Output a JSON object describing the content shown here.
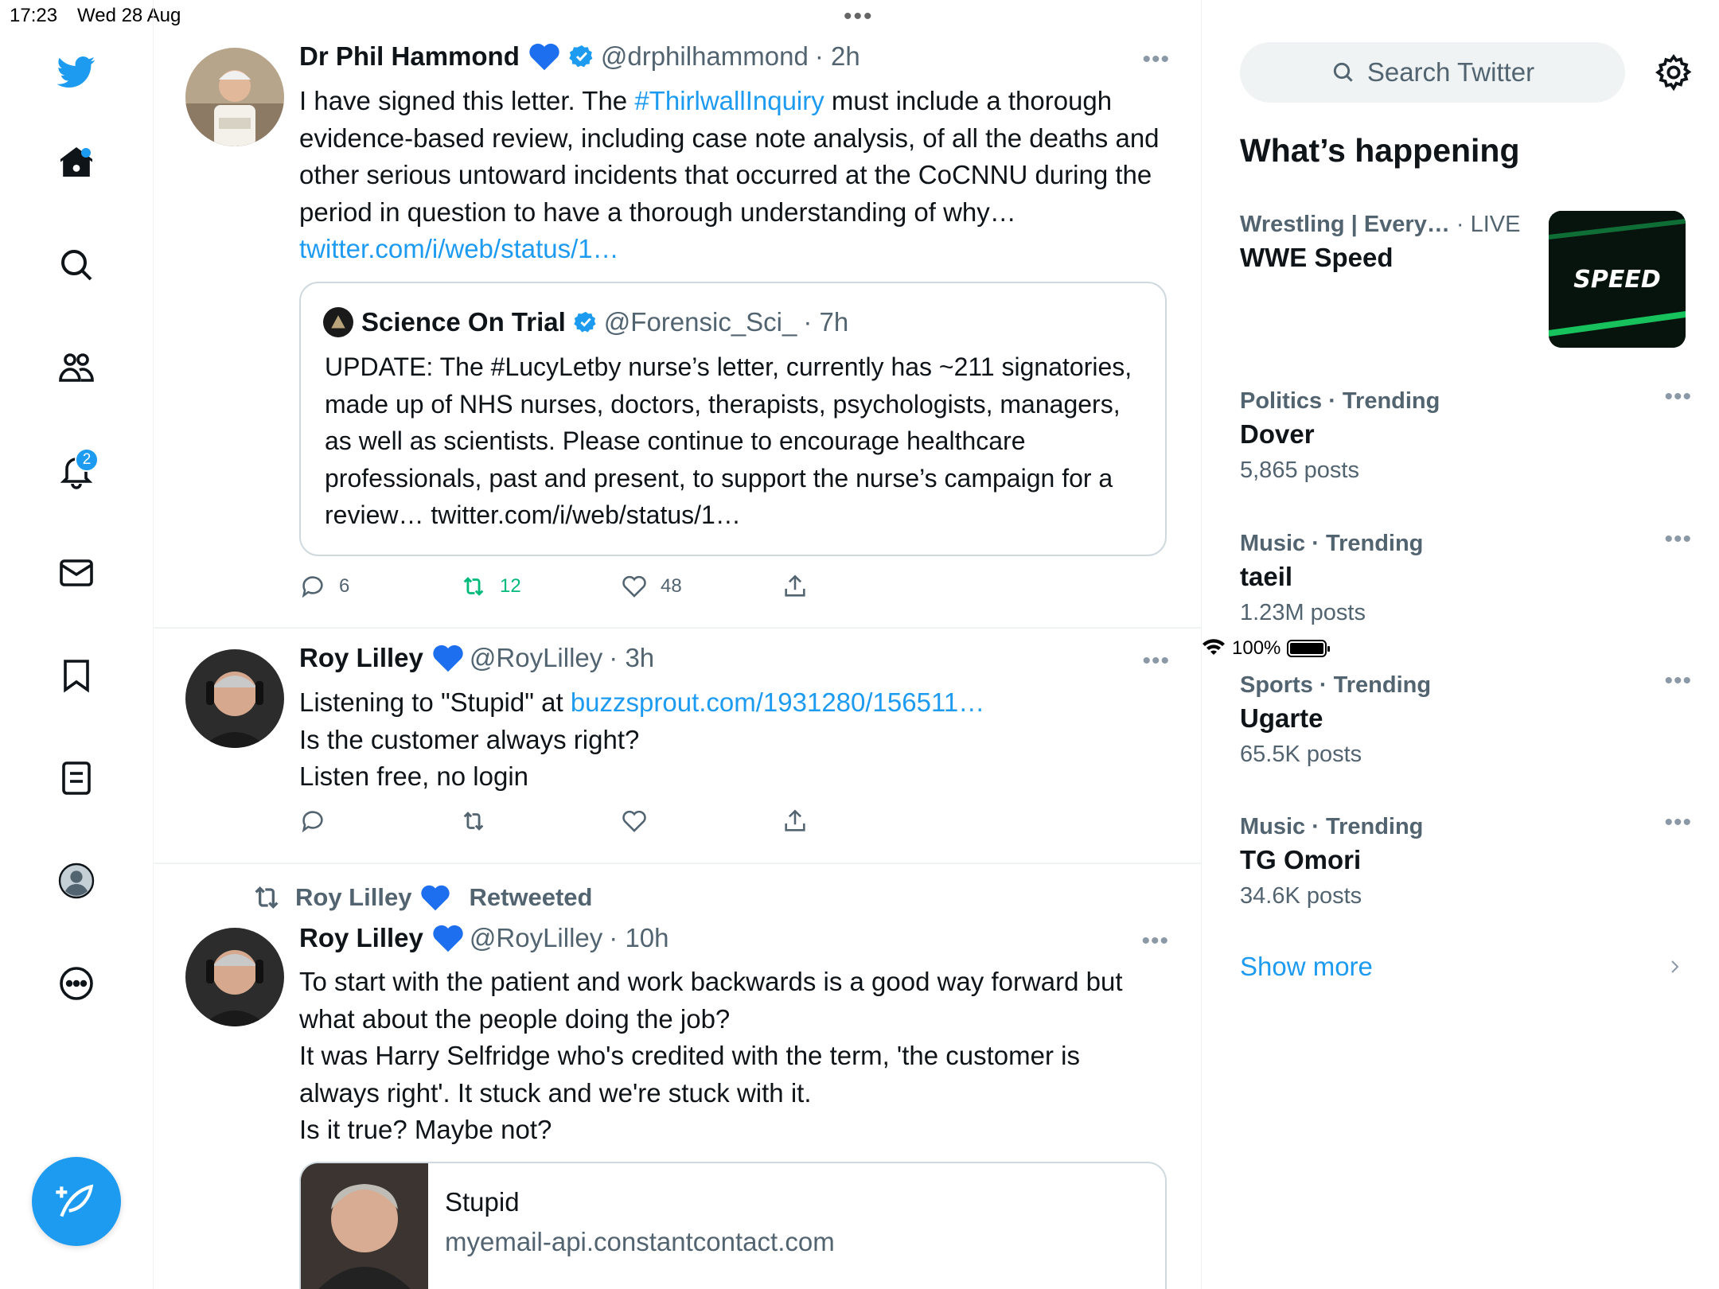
{
  "status": {
    "time": "17:23",
    "date": "Wed 28 Aug",
    "battery": "100%"
  },
  "nav": {
    "notifications_badge": "2"
  },
  "tweets": [
    {
      "name": "Dr Phil Hammond",
      "handle": "@drphilhammond",
      "time": "· 2h",
      "text_before_tag": "I have signed this letter. The ",
      "hashtag": "#ThirlwallInquiry",
      "text_after_tag": " must include a thorough evidence-based review, including case note analysis, of all the deaths and other serious untoward incidents that occurred at the CoCNNU during the period in question to have a thorough understanding of why…",
      "link": "twitter.com/i/web/status/1…",
      "quote": {
        "name": "Science On Trial",
        "handle": "@Forensic_Sci_",
        "time": "· 7h",
        "text": "UPDATE: The #LucyLetby nurse’s letter, currently has ~211 signatories, made up of NHS nurses, doctors, therapists, psychologists, managers, as well as scientists. Please continue to encourage healthcare professionals, past and present, to support the nurse’s campaign for a review… twitter.com/i/web/status/1…"
      },
      "replies": "6",
      "retweets": "12",
      "likes": "48"
    },
    {
      "name": "Roy Lilley",
      "handle": "@RoyLilley",
      "time": "· 3h",
      "text_line1_before": "Listening to \"Stupid\" at ",
      "link": "buzzsprout.com/1931280/156511…",
      "text_line2": "Is the customer always right?",
      "text_line3": "Listen free, no login"
    },
    {
      "retweeted_by": "Roy Lilley",
      "retweeted_label": "Retweeted",
      "name": "Roy Lilley",
      "handle": "@RoyLilley",
      "time": "· 10h",
      "text": "To start with the patient and work backwards is a good way forward but what about the people doing the job?\nIt was Harry Selfridge who's credited with the term, 'the customer is always right'. It stuck and we're stuck with it.\nIs it true? Maybe not?",
      "card": {
        "title": "Stupid",
        "domain": "myemail-api.constantcontact.com"
      }
    }
  ],
  "sidebar": {
    "search_placeholder": "Search Twitter",
    "title": "What’s happening",
    "live": {
      "category": "Wrestling | Every…",
      "tag": "· LIVE",
      "name": "WWE Speed",
      "thumb_text": "SPEED"
    },
    "trends": [
      {
        "category": "Politics · Trending",
        "name": "Dover",
        "count": "5,865 posts"
      },
      {
        "category": "Music · Trending",
        "name": "taeil",
        "count": "1.23M posts"
      },
      {
        "category": "Sports · Trending",
        "name": "Ugarte",
        "count": "65.5K posts"
      },
      {
        "category": "Music · Trending",
        "name": "TG Omori",
        "count": "34.6K posts"
      }
    ],
    "show_more": "Show more"
  },
  "colors": {
    "accent": "#1d9bf0",
    "retweet": "#00ba7c",
    "secondary_text": "#536471",
    "border": "#eff3f4"
  }
}
